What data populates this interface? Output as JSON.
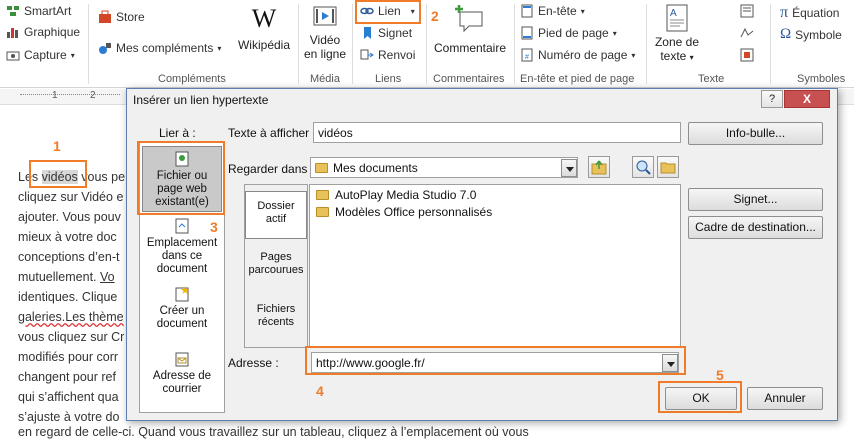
{
  "ribbon": {
    "smartart": "SmartArt",
    "graphique": "Graphique",
    "capture": "Capture",
    "store": "Store",
    "mes_complements": "Mes compléments",
    "wikipedia": "Wikipédia",
    "video_line1": "Vidéo",
    "video_line2": "en ligne",
    "lien": "Lien",
    "signet": "Signet",
    "renvoi": "Renvoi",
    "commentaire": "Commentaire",
    "entete": "En-tête",
    "pied": "Pied de page",
    "numero": "Numéro de page",
    "zone_line1": "Zone de",
    "zone_line2": "texte",
    "equation": "Équation",
    "symbole": "Symbole",
    "groups": {
      "complements": "Compléments",
      "media": "Média",
      "liens": "Liens",
      "commentaires": "Commentaires",
      "entete_pied": "En-tête et pied de page",
      "texte": "Texte",
      "symboles": "Symboles"
    }
  },
  "ruler": {
    "n1": "1",
    "n2": "2"
  },
  "document": {
    "lines": [
      {
        "pre": "Les ",
        "hl": "vidéos",
        "post": " vous pe"
      },
      {
        "pre": "cliquez sur Vidéo e",
        "hl": "",
        "post": ""
      },
      {
        "pre": "ajouter. Vous pouv",
        "hl": "",
        "post": ""
      },
      {
        "pre": "mieux à votre doc",
        "hl": "",
        "post": ""
      },
      {
        "pre": "conceptions d’en-t",
        "hl": "",
        "post": ""
      },
      {
        "pre": "mutuellement. ",
        "hl": "",
        "post": "Vo"
      },
      {
        "pre": "identiques. Clique",
        "hl": "",
        "post": ""
      },
      {
        "pre": "galeries.Les thème",
        "hl": "",
        "post": ""
      },
      {
        "pre": "vous cliquez sur Cr",
        "hl": "",
        "post": ""
      },
      {
        "pre": "modifiés pour corr",
        "hl": "",
        "post": ""
      },
      {
        "pre": "changent pour ref",
        "hl": "",
        "post": ""
      },
      {
        "pre": "qui s’affichent qua",
        "hl": "",
        "post": ""
      },
      {
        "pre": "s’ajuste à votre do",
        "hl": "",
        "post": ""
      },
      {
        "pre": "en regard de celle-ci. Quand vous travaillez sur un tableau, cliquez à l’emplacement où vous",
        "hl": "",
        "post": ""
      }
    ]
  },
  "dialog": {
    "title": "Insérer un lien hypertexte",
    "help": "?",
    "close": "X",
    "lier_a": "Lier à :",
    "texte_a_afficher_label": "Texte à afficher :",
    "texte_a_afficher_value": "vidéos",
    "info_bulle": "Info-bulle...",
    "regarder_dans_label": "Regarder dans :",
    "regarder_dans_value": "Mes documents",
    "link_to": [
      {
        "line1": "Fichier ou",
        "line2": "page web",
        "line3": "existant(e)"
      },
      {
        "line1": "Emplacement",
        "line2": "dans ce",
        "line3": "document"
      },
      {
        "line1": "Créer un",
        "line2": "document",
        "line3": ""
      },
      {
        "line1": "Adresse de",
        "line2": "courrier",
        "line3": ""
      }
    ],
    "sub": [
      {
        "line1": "Dossier",
        "line2": "actif"
      },
      {
        "line1": "Pages",
        "line2": "parcourues"
      },
      {
        "line1": "Fichiers",
        "line2": "récents"
      }
    ],
    "files": [
      "AutoPlay Media Studio 7.0",
      "Modèles Office personnalisés"
    ],
    "signet": "Signet...",
    "cadre": "Cadre de destination...",
    "adresse_label": "Adresse :",
    "adresse_value": "http://www.google.fr/",
    "ok": "OK",
    "annuler": "Annuler"
  },
  "annotations": [
    "1",
    "2",
    "3",
    "4",
    "5"
  ],
  "colors": {
    "annotation": "#f07c2a",
    "close": "#c75050"
  }
}
